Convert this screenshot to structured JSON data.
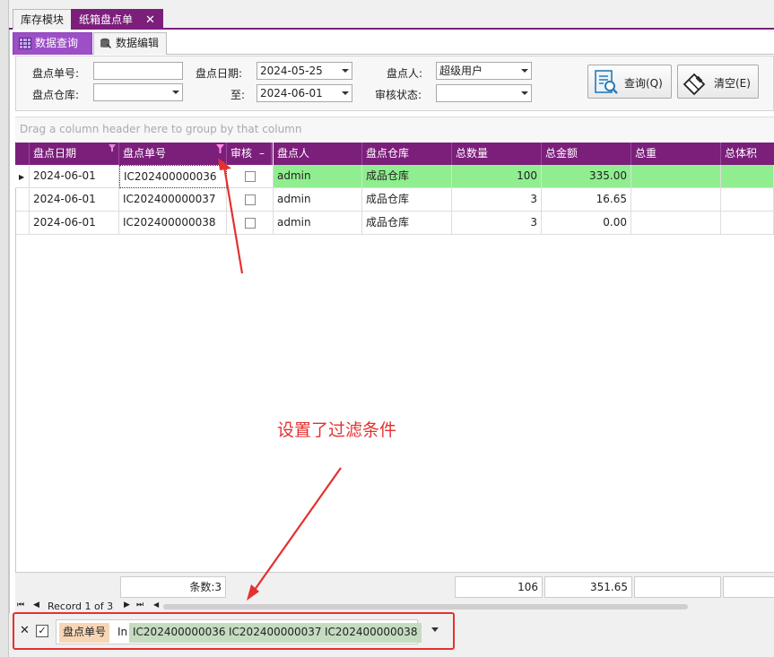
{
  "outer_tabs": [
    {
      "label": "库存模块"
    },
    {
      "label": "纸箱盘点单"
    }
  ],
  "inner_tabs": [
    {
      "label": "数据查询"
    },
    {
      "label": "数据编辑"
    }
  ],
  "filters": {
    "order_no_label": "盘点单号:",
    "order_no_value": "",
    "date_label": "盘点日期:",
    "date_from": "2024-05-25",
    "person_label": "盘点人:",
    "person_value": "超级用户",
    "warehouse_label": "盘点仓库:",
    "warehouse_value": "",
    "to_label": "至:",
    "date_to": "2024-06-01",
    "audit_label": "审核状态:",
    "audit_value": ""
  },
  "buttons": {
    "query": "查询(Q)",
    "clear": "清空(E)"
  },
  "group_hint": "Drag a column header here to group by that column",
  "columns": [
    "盘点日期",
    "盘点单号",
    "审核",
    "盘点人",
    "盘点仓库",
    "总数量",
    "总金额",
    "总重",
    "总体积"
  ],
  "rows": [
    {
      "date": "2024-06-01",
      "no": "IC202400000036",
      "person": "admin",
      "warehouse": "成品仓库",
      "qty": "100",
      "amount": "335.00"
    },
    {
      "date": "2024-06-01",
      "no": "IC202400000037",
      "person": "admin",
      "warehouse": "成品仓库",
      "qty": "3",
      "amount": "16.65"
    },
    {
      "date": "2024-06-01",
      "no": "IC202400000038",
      "person": "admin",
      "warehouse": "成品仓库",
      "qty": "3",
      "amount": "0.00"
    }
  ],
  "footer": {
    "count": "条数:3",
    "qty_total": "106",
    "amount_total": "351.65"
  },
  "nav": {
    "record": "Record 1 of 3"
  },
  "filter_bar": {
    "field": "盘点单号",
    "op": "In",
    "values": [
      "IC202400000036",
      "IC202400000037",
      "IC202400000038"
    ]
  },
  "annotation": {
    "text": "设置了过滤条件"
  },
  "colors": {
    "header": "#7b1f7b",
    "selected_row": "#90ee90",
    "annotation": "#e53030"
  }
}
